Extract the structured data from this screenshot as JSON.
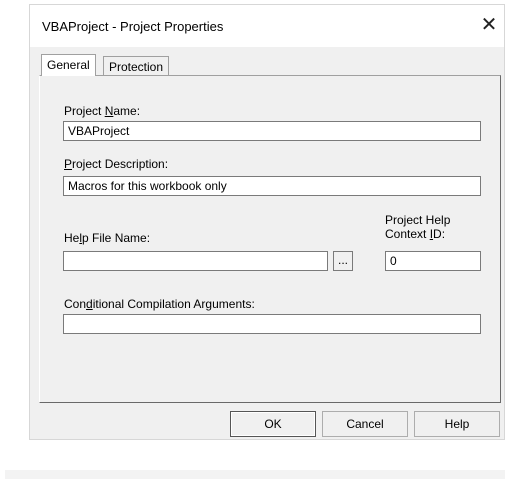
{
  "window": {
    "title": "VBAProject - Project Properties",
    "close_glyph": "✕"
  },
  "tabs": [
    {
      "label": "General",
      "active": true
    },
    {
      "label": "Protection",
      "active": false
    }
  ],
  "fields": {
    "project_name": {
      "label_pre": "Project ",
      "label_key": "N",
      "label_post": "ame:",
      "value": "VBAProject"
    },
    "project_description": {
      "label_pre": "",
      "label_key": "P",
      "label_post": "roject Description:",
      "value": "Macros for this workbook only"
    },
    "help_file": {
      "label_pre": "He",
      "label_key": "l",
      "label_post": "p File Name:",
      "value": "",
      "browse_label": "..."
    },
    "context_id": {
      "line1": "Project Help",
      "line2_pre": "Context ",
      "line2_key": "I",
      "line2_post": "D:",
      "value": "0"
    },
    "conditional": {
      "label_pre": "Con",
      "label_key": "d",
      "label_post": "itional Compilation Arguments:",
      "value": ""
    }
  },
  "buttons": {
    "ok": "OK",
    "cancel": "Cancel",
    "help": "Help"
  },
  "colors": {
    "dialog_bg": "#f0f0f0",
    "titlebar_bg": "#ffffff",
    "input_border": "#7a7a7a"
  }
}
